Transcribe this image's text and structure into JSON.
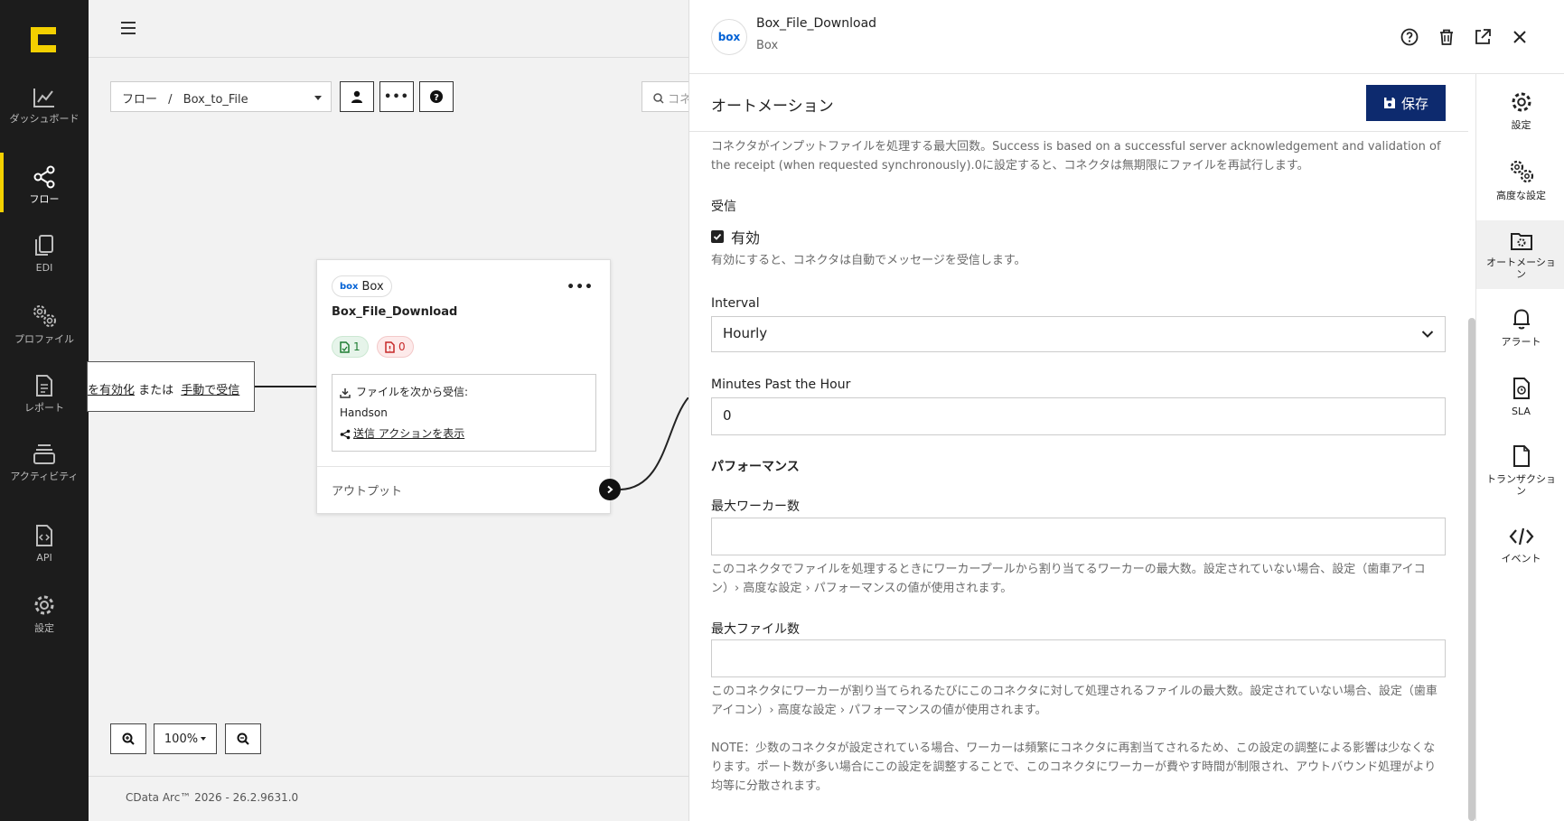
{
  "nav": {
    "items": [
      {
        "label": "ダッシュボード",
        "icon": "chart-line-icon"
      },
      {
        "label": "フロー",
        "icon": "share-nodes-icon"
      },
      {
        "label": "EDI",
        "icon": "documents-icon"
      },
      {
        "label": "プロファイル",
        "icon": "gears-icon"
      },
      {
        "label": "レポート",
        "icon": "report-icon"
      },
      {
        "label": "アクティビティ",
        "icon": "layers-icon"
      },
      {
        "label": "API",
        "icon": "api-file-icon"
      },
      {
        "label": "設定",
        "icon": "gear-icon"
      }
    ],
    "active": "フロー",
    "accent": "#f3d000"
  },
  "toolbar": {
    "breadcrumb_root": "フロー",
    "breadcrumb_sep": "/",
    "breadcrumb_current": "Box_to_File",
    "search_placeholder": "コネ"
  },
  "flow": {
    "receive_prefix": "を有効化",
    "receive_mid": " または ",
    "receive_link": "手動で受信",
    "node": {
      "tag": "Box",
      "tag_logo": "box",
      "title": "Box_File_Download",
      "success_count": "1",
      "error_count": "0",
      "receive_from": "ファイルを次から受信:",
      "source": "Handson",
      "send_action_link": "送信 アクションを表示",
      "output_label": "アウトプット"
    }
  },
  "zoom": {
    "level": "100%"
  },
  "footer": {
    "version": "CData Arc™ 2026 - 26.2.9631.0"
  },
  "panel": {
    "title": "Box_File_Download",
    "subtitle": "Box",
    "avatar_text": "box",
    "section_title": "オートメーション",
    "save_label": "保存",
    "retry_help": "コネクタがインプットファイルを処理する最大回数。Success is based on a successful server acknowledgement and validation of the receipt (when requested synchronously).0に設定すると、コネクタは無期限にファイルを再試行します。",
    "receive_label": "受信",
    "receive_checkbox": "有効",
    "receive_help": "有効にすると、コネクタは自動でメッセージを受信します。",
    "interval_label": "Interval",
    "interval_value": "Hourly",
    "minutes_label": "Minutes Past the Hour",
    "minutes_value": "0",
    "performance_label": "パフォーマンス",
    "max_workers_label": "最大ワーカー数",
    "max_workers_value": "",
    "max_workers_help": "このコネクタでファイルを処理するときにワーカープールから割り当てるワーカーの最大数。設定されていない場合、設定（歯車アイコン）› 高度な設定 › パフォーマンスの値が使用されます。",
    "max_files_label": "最大ファイル数",
    "max_files_value": "",
    "max_files_help": "このコネクタにワーカーが割り当てられるたびにこのコネクタに対して処理されるファイルの最大数。設定されていない場合、設定（歯車アイコン）› 高度な設定 › パフォーマンスの値が使用されます。",
    "note": "NOTE：少数のコネクタが設定されている場合、ワーカーは頻繁にコネクタに再割当てされるため、この設定の調整による影響は少なくなります。ポート数が多い場合にこの設定を調整することで、このコネクタにワーカーが費やす時間が制限され、アウトバウンド処理がより均等に分散されます。",
    "save_color": "#0d2a6e"
  },
  "rail": {
    "items": [
      {
        "label": "設定",
        "icon": "gear-icon"
      },
      {
        "label": "高度な設定",
        "icon": "gears-icon"
      },
      {
        "label": "オートメーション",
        "icon": "folder-gear-icon"
      },
      {
        "label": "アラート",
        "icon": "bell-icon"
      },
      {
        "label": "SLA",
        "icon": "sla-file-icon"
      },
      {
        "label": "トランザクション",
        "icon": "file-icon"
      },
      {
        "label": "イベント",
        "icon": "code-icon"
      }
    ],
    "active": "オートメーション"
  }
}
